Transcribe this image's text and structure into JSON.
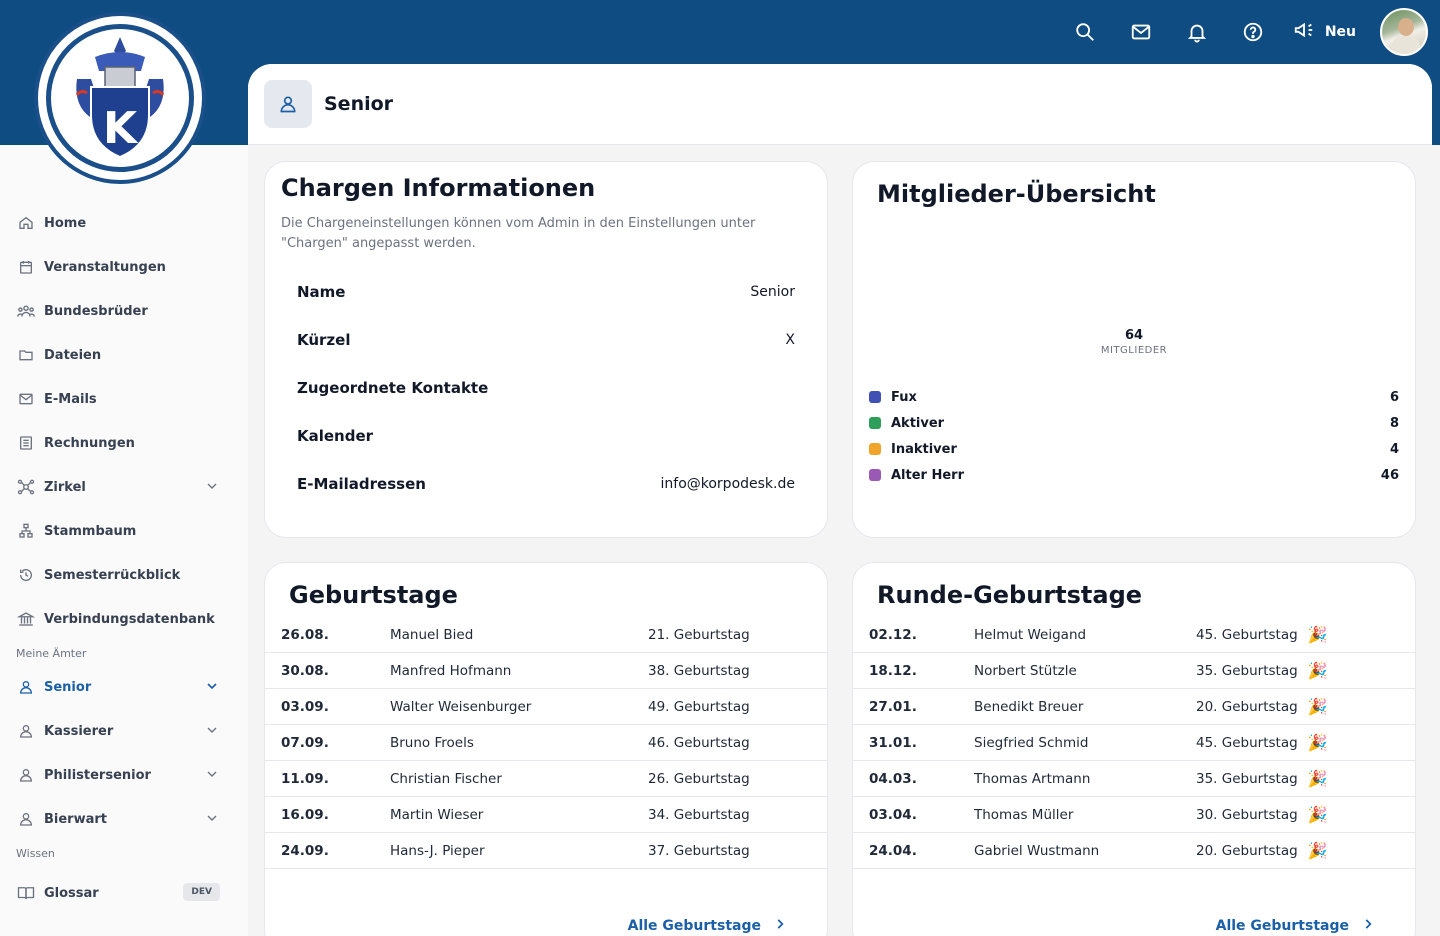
{
  "topbar": {
    "neu_label": "Neu",
    "brand_letter": "K"
  },
  "sidebar": {
    "items": [
      {
        "label": "Home"
      },
      {
        "label": "Veranstaltungen"
      },
      {
        "label": "Bundesbrüder"
      },
      {
        "label": "Dateien"
      },
      {
        "label": "E-Mails"
      },
      {
        "label": "Rechnungen"
      },
      {
        "label": "Zirkel"
      },
      {
        "label": "Stammbaum"
      },
      {
        "label": "Semesterrückblick"
      },
      {
        "label": "Verbindungsdatenbank"
      }
    ],
    "section_aemter": "Meine Ämter",
    "aemter": [
      {
        "label": "Senior"
      },
      {
        "label": "Kassierer"
      },
      {
        "label": "Philistersenior"
      },
      {
        "label": "Bierwart"
      }
    ],
    "section_wissen": "Wissen",
    "glossar": {
      "label": "Glossar",
      "badge": "DEV"
    }
  },
  "page": {
    "title": "Senior"
  },
  "chargen": {
    "title": "Chargen Informationen",
    "description": "Die Chargeneinstellungen können vom Admin in den Einstellungen unter \"Chargen\" angepasst werden.",
    "rows": [
      {
        "key": "Name",
        "value": "Senior"
      },
      {
        "key": "Kürzel",
        "value": "X"
      },
      {
        "key": "Zugeordnete Kontakte",
        "value": ""
      },
      {
        "key": "Kalender",
        "value": ""
      },
      {
        "key": "E-Mailadressen",
        "value": "info@korpodesk.de"
      }
    ]
  },
  "members": {
    "title": "Mitglieder-Übersicht",
    "total": "64",
    "total_label": "MITGLIEDER",
    "legend": [
      {
        "label": "Fux",
        "count": "6",
        "color": "#3f51b5"
      },
      {
        "label": "Aktiver",
        "count": "8",
        "color": "#2e9e5b"
      },
      {
        "label": "Inaktiver",
        "count": "4",
        "color": "#f0a52a"
      },
      {
        "label": "Alter Herr",
        "count": "46",
        "color": "#9b59b6"
      }
    ]
  },
  "birthdays": {
    "title": "Geburtstage",
    "rows": [
      {
        "date": "26.08.",
        "name": "Manuel Bied",
        "info": "21. Geburtstag"
      },
      {
        "date": "30.08.",
        "name": "Manfred Hofmann",
        "info": "38. Geburtstag"
      },
      {
        "date": "03.09.",
        "name": "Walter Weisenburger",
        "info": "49. Geburtstag"
      },
      {
        "date": "07.09.",
        "name": "Bruno Froels",
        "info": "46. Geburtstag"
      },
      {
        "date": "11.09.",
        "name": "Christian Fischer",
        "info": "26. Geburtstag"
      },
      {
        "date": "16.09.",
        "name": "Martin Wieser",
        "info": "34. Geburtstag"
      },
      {
        "date": "24.09.",
        "name": "Hans-J. Pieper",
        "info": "37. Geburtstag"
      }
    ],
    "all_label": "Alle Geburtstage"
  },
  "round_birthdays": {
    "title": "Runde-Geburtstage",
    "rows": [
      {
        "date": "02.12.",
        "name": "Helmut Weigand",
        "info": "45. Geburtstag"
      },
      {
        "date": "18.12.",
        "name": "Norbert Stützle",
        "info": "35. Geburtstag"
      },
      {
        "date": "27.01.",
        "name": "Benedikt Breuer",
        "info": "20. Geburtstag"
      },
      {
        "date": "31.01.",
        "name": "Siegfried Schmid",
        "info": "45. Geburtstag"
      },
      {
        "date": "04.03.",
        "name": "Thomas Artmann",
        "info": "35. Geburtstag"
      },
      {
        "date": "03.04.",
        "name": "Thomas Müller",
        "info": "30. Geburtstag"
      },
      {
        "date": "24.04.",
        "name": "Gabriel Wustmann",
        "info": "20. Geburtstag"
      }
    ],
    "all_label": "Alle Geburtstage",
    "party_icon": "🎉"
  }
}
